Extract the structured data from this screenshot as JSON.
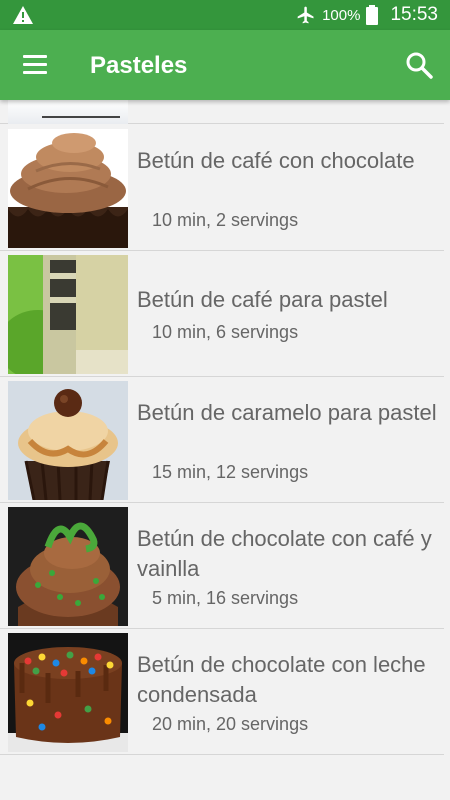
{
  "status_bar": {
    "battery_percent": "100%",
    "time": "15:53",
    "icons": [
      "warning-icon",
      "airplane-mode-icon",
      "battery-icon"
    ]
  },
  "app_bar": {
    "title": "Pasteles",
    "menu_icon": "menu-icon",
    "search_icon": "search-icon"
  },
  "colors": {
    "status_bar": "#34963c",
    "app_bar": "#4caf50",
    "text": "#666666",
    "background": "#f2f2f2"
  },
  "recipes": [
    {
      "title": "Betún de café con chocolate",
      "meta": "10 min, 2 servings"
    },
    {
      "title": "Betún de café para pastel",
      "meta": "10 min, 6 servings"
    },
    {
      "title": "Betún de caramelo para pastel",
      "meta": "15 min, 12 servings"
    },
    {
      "title": "Betún de chocolate con café y vainlla",
      "meta": "5 min, 16 servings"
    },
    {
      "title": "Betún de chocolate con leche condensada",
      "meta": "20 min, 20 servings"
    }
  ]
}
